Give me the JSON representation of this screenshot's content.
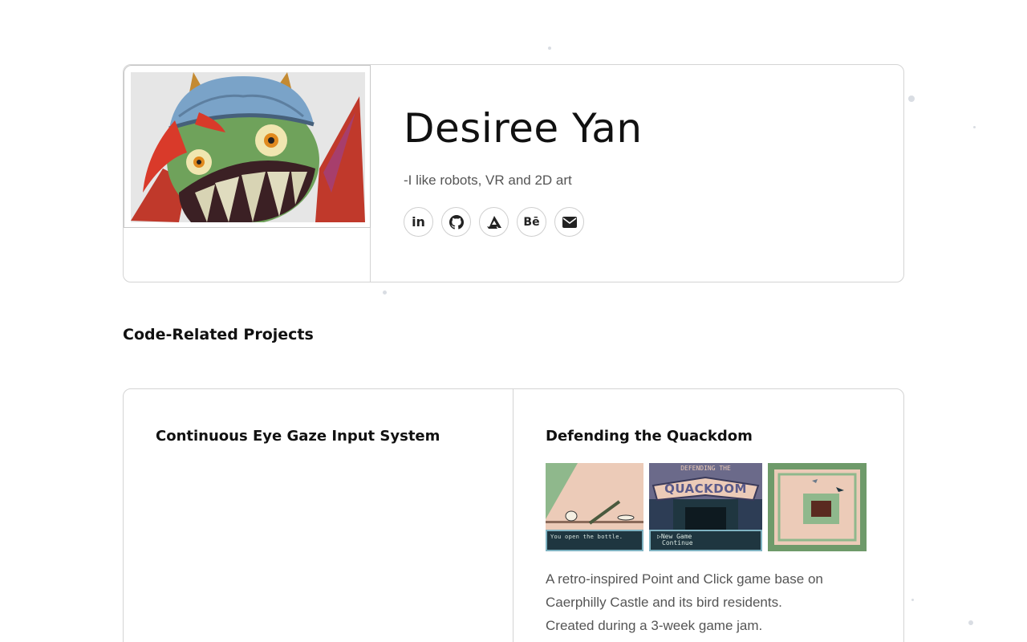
{
  "profile": {
    "name": "Desiree Yan",
    "tagline": "-I like robots, VR and 2D art",
    "socials": [
      {
        "icon": "linkedin-icon",
        "label": "in"
      },
      {
        "icon": "github-icon",
        "label": ""
      },
      {
        "icon": "artstation-icon",
        "label": ""
      },
      {
        "icon": "behance-icon",
        "label": "Bē"
      },
      {
        "icon": "email-icon",
        "label": ""
      }
    ]
  },
  "sections": {
    "code_projects_title": "Code-Related Projects"
  },
  "projects": [
    {
      "title": "Continuous Eye Gaze Input System"
    },
    {
      "title": "Defending the Quackdom",
      "thumb_texts": {
        "dialog": "You open the bottle.",
        "title_top": "DEFENDING THE",
        "title_main": "QUACKDOM",
        "menu_1": "New Game",
        "menu_2": "Continue"
      },
      "description_line1": "A retro-inspired Point and Click game base on",
      "description_line2": "Caerphilly Castle and its bird residents.",
      "description_line3": "Created during a 3-week game jam."
    }
  ],
  "colors": {
    "border": "#d4d4d4",
    "text_primary": "#111111",
    "text_secondary": "#555555",
    "gb_pink": "#eccbb8",
    "gb_green": "#8fb88c",
    "gb_dark": "#1f3640"
  }
}
